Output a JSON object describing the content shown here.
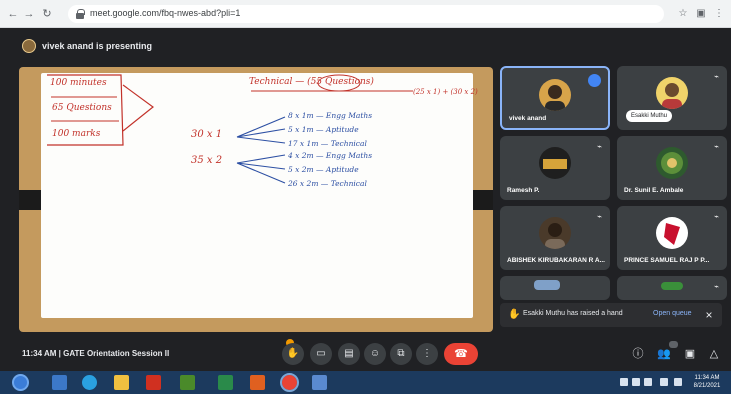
{
  "browser": {
    "url": "meet.google.com/fbq-nwes-abd?pli=1",
    "icons": [
      "back-icon",
      "forward-icon",
      "reload-icon",
      "lock-icon",
      "star-icon",
      "extensions-icon",
      "menu-icon"
    ]
  },
  "meet": {
    "presenting_label": "vivek anand is presenting",
    "meeting_time": "11:34 AM",
    "meeting_title": "GATE Orientation Session II",
    "toast": {
      "message": "Esakki Muthu has raised a hand",
      "action": "Open queue"
    },
    "participants": [
      {
        "name": "vivek anand",
        "speaking": true
      },
      {
        "name": "Esakki Muthu",
        "pill": true
      },
      {
        "name": "Ramesh P."
      },
      {
        "name": "Dr. Sunil E. Ambale"
      },
      {
        "name": "ABISHEK KIRUBAKARAN R A..."
      },
      {
        "name": "PRINCE SAMUEL RAJ P P..."
      },
      {
        "name": ""
      },
      {
        "name": ""
      }
    ],
    "controls": [
      "raise-hand",
      "captions",
      "present",
      "emoji",
      "present-screen",
      "more-options",
      "end-call"
    ],
    "right_controls": [
      "info",
      "people",
      "chat",
      "activities"
    ]
  },
  "whiteboard": {
    "left_items": [
      "100 minutes",
      "65 Questions",
      "100 marks"
    ],
    "header": "Technical — (55 Questions)",
    "header_extra": "(25 x 1) + (30 x 2)",
    "groups": [
      "30 x 1",
      "35 x 2"
    ],
    "group1_items": [
      "8 x 1m — Engg Maths",
      "5 x 1m — Aptitude",
      "17 x 1m — Technical"
    ],
    "group2_items": [
      "4 x 2m — Engg Maths",
      "5 x 2m — Aptitude",
      "26 x 2m — Technical"
    ]
  },
  "taskbar": {
    "clock_time": "11:34 AM",
    "clock_date": "8/21/2021"
  }
}
